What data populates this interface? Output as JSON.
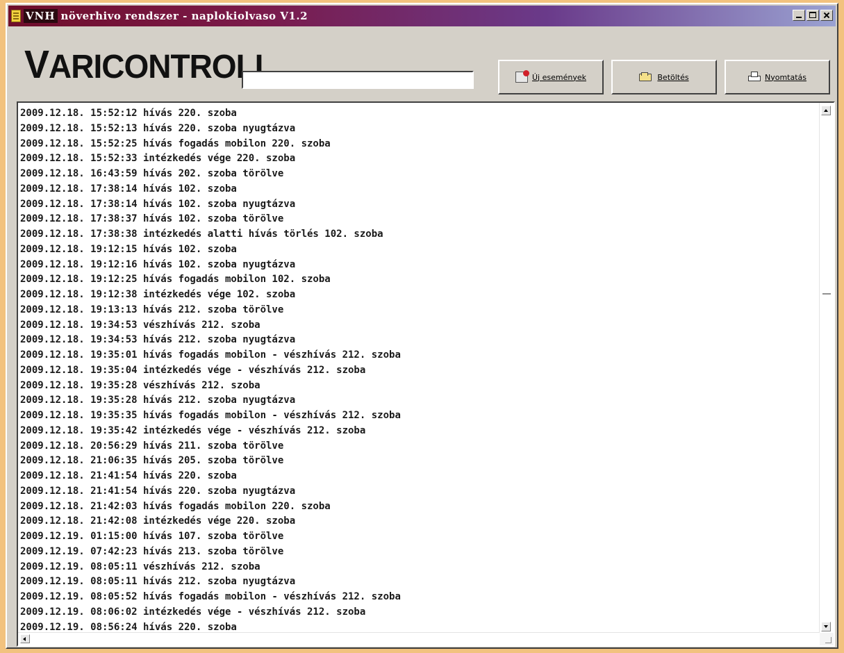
{
  "window": {
    "badge": "VNH",
    "title": "növerhivo rendszer - naplokiolvaso V1.2"
  },
  "logo": {
    "letter": "V",
    "rest": "ARICONTROLL"
  },
  "search": {
    "value": ""
  },
  "toolbar": {
    "new_events_label": "Új események",
    "load_label": "Betöltés",
    "print_label": "Nyomtatás"
  },
  "log": {
    "lines": [
      "2009.12.18. 15:52:12 hívás 220. szoba",
      "2009.12.18. 15:52:13 hívás 220. szoba nyugtázva",
      "2009.12.18. 15:52:25 hívás fogadás mobilon 220. szoba",
      "2009.12.18. 15:52:33 intézkedés vége 220. szoba",
      "2009.12.18. 16:43:59 hívás 202. szoba törölve",
      "2009.12.18. 17:38:14 hívás 102. szoba",
      "2009.12.18. 17:38:14 hívás 102. szoba nyugtázva",
      "2009.12.18. 17:38:37 hívás 102. szoba törölve",
      "2009.12.18. 17:38:38 intézkedés alatti hívás törlés 102. szoba",
      "2009.12.18. 19:12:15 hívás 102. szoba",
      "2009.12.18. 19:12:16 hívás 102. szoba nyugtázva",
      "2009.12.18. 19:12:25 hívás fogadás mobilon 102. szoba",
      "2009.12.18. 19:12:38 intézkedés vége 102. szoba",
      "2009.12.18. 19:13:13 hívás 212. szoba törölve",
      "2009.12.18. 19:34:53 vészhívás 212. szoba",
      "2009.12.18. 19:34:53 hívás 212. szoba nyugtázva",
      "2009.12.18. 19:35:01 hívás fogadás mobilon - vészhívás 212. szoba",
      "2009.12.18. 19:35:04 intézkedés vége - vészhívás 212. szoba",
      "2009.12.18. 19:35:28 vészhívás 212. szoba",
      "2009.12.18. 19:35:28 hívás 212. szoba nyugtázva",
      "2009.12.18. 19:35:35 hívás fogadás mobilon - vészhívás 212. szoba",
      "2009.12.18. 19:35:42 intézkedés vége - vészhívás 212. szoba",
      "2009.12.18. 20:56:29 hívás 211. szoba törölve",
      "2009.12.18. 21:06:35 hívás 205. szoba törölve",
      "2009.12.18. 21:41:54 hívás 220. szoba",
      "2009.12.18. 21:41:54 hívás 220. szoba nyugtázva",
      "2009.12.18. 21:42:03 hívás fogadás mobilon 220. szoba",
      "2009.12.18. 21:42:08 intézkedés vége 220. szoba",
      "2009.12.19. 01:15:00 hívás 107. szoba törölve",
      "2009.12.19. 07:42:23 hívás 213. szoba törölve",
      "2009.12.19. 08:05:11 vészhívás 212. szoba",
      "2009.12.19. 08:05:11 hívás 212. szoba nyugtázva",
      "2009.12.19. 08:05:52 hívás fogadás mobilon - vészhívás 212. szoba",
      "2009.12.19. 08:06:02 intézkedés vége - vészhívás 212. szoba",
      "2009.12.19. 08:56:24 hívás 220. szoba"
    ]
  },
  "icons": {
    "app": "notepad-icon",
    "new_events": "new-events-icon",
    "load": "folder-icon",
    "print": "printer-icon"
  },
  "colors": {
    "background": "#f2c27e",
    "titlebar_start": "#6f0e2b",
    "titlebar_end": "#9aa2d2",
    "window": "#d4d0c8"
  }
}
